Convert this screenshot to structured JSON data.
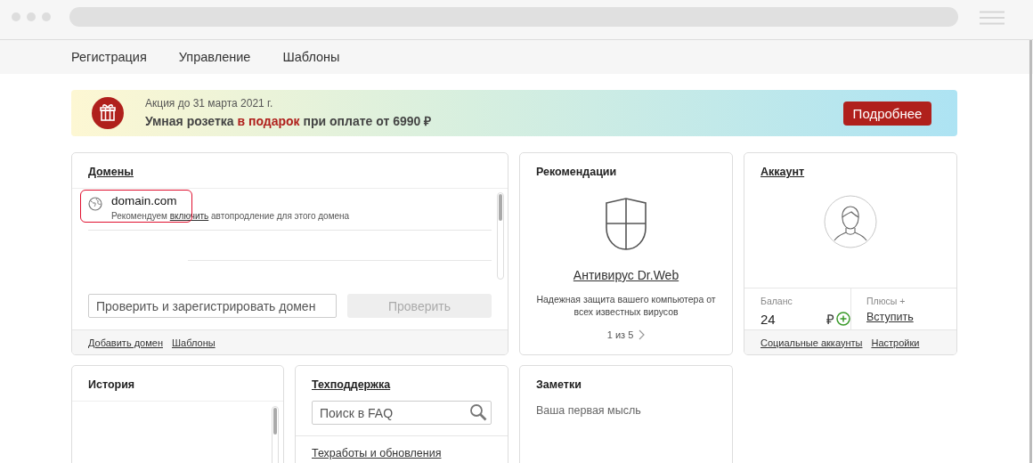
{
  "browser": {
    "nav": [
      {
        "label": "Регистрация"
      },
      {
        "label": "Управление"
      },
      {
        "label": "Шаблоны"
      }
    ]
  },
  "banner": {
    "date": "Акция до 31 марта 2021 г.",
    "headline": [
      {
        "text": "Умная розетка ",
        "accent": false
      },
      {
        "text": "в подарок",
        "accent": true
      },
      {
        "text": " при оплате от 6990 ₽",
        "accent": false
      }
    ],
    "button": "Подробнее"
  },
  "domains": {
    "title": "Домены",
    "title_is_link": true,
    "items": [
      {
        "name": "domain.com",
        "highlighted": true,
        "note_before": "Рекомендуем ",
        "note_link": "включить",
        "note_after": " автопродление для этого домена"
      }
    ],
    "search": {
      "placeholder": "Проверить и зарегистрировать домен"
    },
    "check_button": {
      "label": "Проверить",
      "disabled": true
    },
    "links": [
      "Добавить домен",
      "Шаблоны"
    ]
  },
  "recommendations": {
    "title": "Рекомендации",
    "title_is_link": false,
    "product": "Антивирус Dr.Web",
    "description": "Надежная защита вашего компьютера от всех известных вирусов",
    "pager": "1 из 5"
  },
  "account": {
    "title": "Аккаунт",
    "title_is_link": true,
    "balance_label": "Баланс",
    "balance": "24",
    "currency": "₽",
    "plus_label": "Плюсы +",
    "join": "Вступить",
    "links": [
      "Социальные аккаунты",
      "Настройки"
    ]
  },
  "history": {
    "title": "История",
    "title_is_link": false
  },
  "support": {
    "title": "Техподдержка",
    "title_is_link": true,
    "search": {
      "placeholder": "Поиск в FAQ"
    },
    "links": [
      "Техработы и обновления"
    ]
  },
  "notes": {
    "title": "Заметки",
    "title_is_link": false,
    "placeholder": "Ваша первая мысль"
  }
}
